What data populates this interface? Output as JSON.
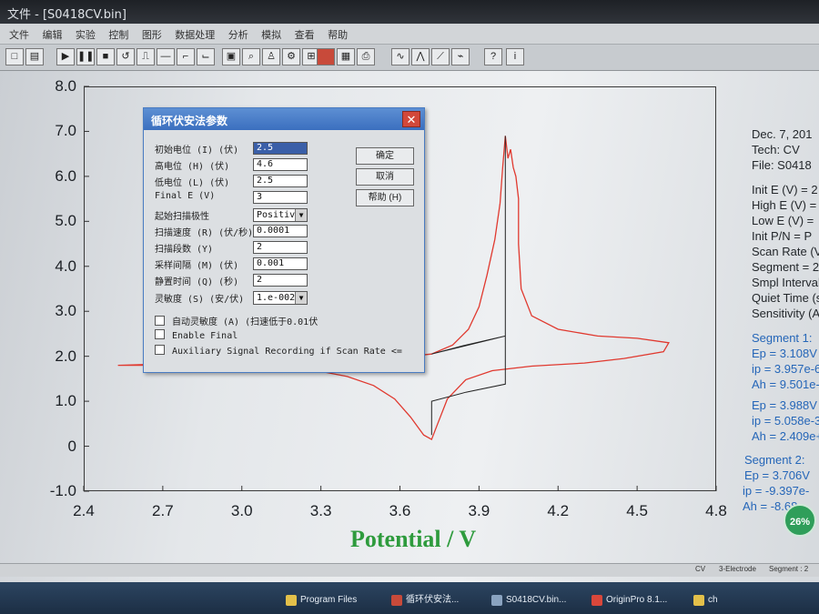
{
  "window": {
    "title": "文件 - [S0418CV.bin]"
  },
  "menu": [
    "文件",
    "编辑",
    "实验",
    "控制",
    "图形",
    "数据处理",
    "分析",
    "模拟",
    "查看",
    "帮助"
  ],
  "chart_data": {
    "type": "line",
    "xlabel": "Potential / V",
    "ylabel": "",
    "xlim": [
      2.4,
      4.8
    ],
    "ylim": [
      -1.0,
      8.0
    ],
    "x_ticks": [
      "2.4",
      "2.7",
      "3.0",
      "3.3",
      "3.6",
      "3.9",
      "4.2",
      "4.5",
      "4.8"
    ],
    "y_ticks": [
      "8.0",
      "7.0",
      "6.0",
      "5.0",
      "4.0",
      "3.0",
      "2.0",
      "1.0",
      "0",
      "-1.0"
    ],
    "series": [
      {
        "color": "#e0392f",
        "points": [
          [
            2.53,
            1.8
          ],
          [
            2.62,
            1.8
          ],
          [
            2.75,
            1.84
          ],
          [
            2.9,
            1.86
          ],
          [
            3.1,
            1.88
          ],
          [
            3.35,
            1.9
          ],
          [
            3.55,
            1.95
          ],
          [
            3.72,
            2.05
          ],
          [
            3.8,
            2.25
          ],
          [
            3.86,
            2.6
          ],
          [
            3.9,
            3.1
          ],
          [
            3.93,
            3.8
          ],
          [
            3.96,
            4.6
          ],
          [
            3.98,
            5.4
          ],
          [
            3.99,
            6.2
          ],
          [
            4.0,
            6.9
          ],
          [
            4.01,
            6.4
          ],
          [
            4.02,
            6.6
          ],
          [
            4.03,
            6.2
          ],
          [
            4.04,
            6.0
          ],
          [
            4.05,
            5.5
          ],
          [
            4.05,
            4.5
          ],
          [
            4.06,
            3.5
          ],
          [
            4.1,
            2.9
          ],
          [
            4.2,
            2.6
          ],
          [
            4.35,
            2.45
          ],
          [
            4.5,
            2.4
          ],
          [
            4.62,
            2.3
          ],
          [
            4.6,
            2.1
          ],
          [
            4.45,
            1.95
          ],
          [
            4.3,
            1.85
          ],
          [
            4.1,
            1.78
          ],
          [
            3.95,
            1.68
          ],
          [
            3.85,
            1.48
          ],
          [
            3.78,
            1.05
          ],
          [
            3.74,
            0.45
          ],
          [
            3.72,
            0.15
          ],
          [
            3.69,
            0.25
          ],
          [
            3.64,
            0.65
          ],
          [
            3.58,
            1.05
          ],
          [
            3.5,
            1.35
          ],
          [
            3.4,
            1.55
          ],
          [
            3.25,
            1.72
          ],
          [
            3.1,
            1.8
          ],
          [
            2.9,
            1.82
          ],
          [
            2.7,
            1.83
          ],
          [
            2.53,
            1.8
          ]
        ]
      },
      {
        "color": "#222222",
        "points": [
          [
            3.72,
            1.0
          ],
          [
            3.72,
            0.25
          ],
          [
            3.72,
            1.0
          ],
          [
            3.85,
            1.2
          ],
          [
            4.0,
            1.38
          ],
          [
            4.0,
            2.45
          ],
          [
            3.85,
            2.25
          ],
          [
            3.72,
            2.05
          ],
          [
            4.0,
            2.45
          ],
          [
            4.0,
            6.9
          ]
        ]
      }
    ]
  },
  "info_panel": {
    "date": "Dec. 7, 201",
    "tech": "Tech: CV",
    "file": "File: S0418",
    "params": [
      "Init E (V) = 2",
      "High E (V) =",
      "Low E (V) =",
      "Init P/N = P",
      "Scan Rate (V",
      "Segment = 2",
      "Smpl Interval",
      "Quiet Time (s",
      "Sensitivity (A"
    ],
    "segment1_title": "Segment 1:",
    "segment1_a": [
      "Ep = 3.108V",
      "ip = 3.957e-6",
      "Ah = 9.501e-"
    ],
    "segment1_b": [
      "Ep = 3.988V",
      "ip = 5.058e-3",
      "Ah = 2.409e+"
    ],
    "segment2_title": "Segment 2:",
    "segment2": [
      "Ep = 3.706V",
      "ip = -9.397e-",
      "Ah = -8.68"
    ]
  },
  "dialog": {
    "title": "循环伏安法参数",
    "fields": [
      {
        "label": "初始电位 (I) (伏)",
        "value": "2.5"
      },
      {
        "label": "高电位 (H) (伏)",
        "value": "4.6"
      },
      {
        "label": "低电位 (L) (伏)",
        "value": "2.5"
      },
      {
        "label": "Final E (V)",
        "value": "3"
      },
      {
        "label": "起始扫描极性",
        "value": "Positive"
      },
      {
        "label": "扫描速度 (R) (伏/秒)",
        "value": "0.0001"
      },
      {
        "label": "扫描段数 (Y)",
        "value": "2"
      },
      {
        "label": "采样间隔 (M) (伏)",
        "value": "0.001"
      },
      {
        "label": "静置时间 (Q) (秒)",
        "value": "2"
      },
      {
        "label": "灵敏度 (S) (安/伏)",
        "value": "1.e-002"
      }
    ],
    "checkboxes": [
      "自动灵敏度 (A) (扫速低于0.01伏",
      "Enable Final",
      "Auxiliary Signal Recording if Scan Rate <="
    ],
    "buttons": {
      "ok": "确定",
      "cancel": "取消",
      "help": "帮助 (H)"
    }
  },
  "statusbar": {
    "mode": "CV",
    "electrode": "3-Electrode",
    "status": "Segment : 2"
  },
  "taskbar": {
    "items": [
      "Program Files",
      "循环伏安法...",
      "S0418CV.bin...",
      "OriginPro 8.1...",
      "ch"
    ]
  },
  "badge": "26%"
}
